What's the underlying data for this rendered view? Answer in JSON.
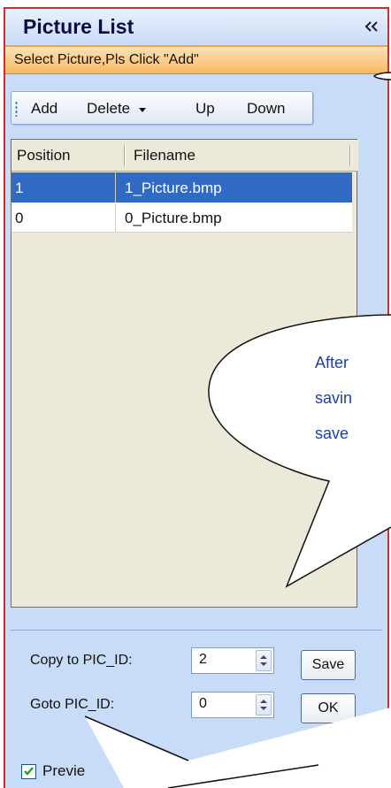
{
  "panel": {
    "title": "Picture List",
    "collapse_glyph": "«",
    "hint": "Select Picture,Pls Click \"Add\""
  },
  "toolbar": {
    "add": "Add",
    "delete": "Delete",
    "up": "Up",
    "down": "Down"
  },
  "grid": {
    "columns": [
      "Position",
      "Filename"
    ],
    "rows": [
      {
        "position": "1",
        "filename": "1_Picture.bmp",
        "selected": true
      },
      {
        "position": "0",
        "filename": "0_Picture.bmp",
        "selected": false
      }
    ]
  },
  "controls": {
    "copy_label": "Copy to PIC_ID:",
    "copy_value": "2",
    "goto_label": "Goto PIC_ID:",
    "goto_value": "0",
    "save": "Save",
    "ok": "OK",
    "preview_label": "Previe",
    "preview_checked": true
  },
  "callout": {
    "lines": [
      "After",
      "savin",
      "save"
    ]
  },
  "colors": {
    "frame_border": "#c9302f",
    "selected_row": "#316ac5",
    "hint_bar": "#f6b864",
    "callout_text": "#1d3fa8"
  }
}
